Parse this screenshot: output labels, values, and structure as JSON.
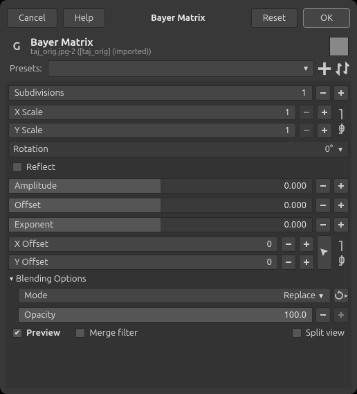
{
  "topbar": {
    "cancel": "Cancel",
    "help": "Help",
    "title": "Bayer Matrix",
    "reset": "Reset",
    "ok": "OK"
  },
  "header": {
    "title": "Bayer Matrix",
    "subtitle": "taj_orig.jpg-2 ([taj_orig] (imported))"
  },
  "presets": {
    "label": "Presets:"
  },
  "params": {
    "subdivisions": {
      "label": "Subdivisions",
      "value": "1"
    },
    "xscale": {
      "label": "X Scale",
      "value": "1"
    },
    "yscale": {
      "label": "Y Scale",
      "value": "1"
    },
    "rotation": {
      "label": "Rotation",
      "value": "0°"
    },
    "reflect": {
      "label": "Reflect"
    },
    "amplitude": {
      "label": "Amplitude",
      "value": "0.000"
    },
    "offset": {
      "label": "Offset",
      "value": "0.000"
    },
    "exponent": {
      "label": "Exponent",
      "value": "0.000"
    },
    "xoffset": {
      "label": "X Offset",
      "value": "0"
    },
    "yoffset": {
      "label": "Y Offset",
      "value": "0"
    }
  },
  "blending": {
    "header": "Blending Options",
    "mode_label": "Mode",
    "mode_value": "Replace",
    "opacity_label": "Opacity",
    "opacity_value": "100.0"
  },
  "footer": {
    "preview": "Preview",
    "merge": "Merge filter",
    "split": "Split view"
  }
}
